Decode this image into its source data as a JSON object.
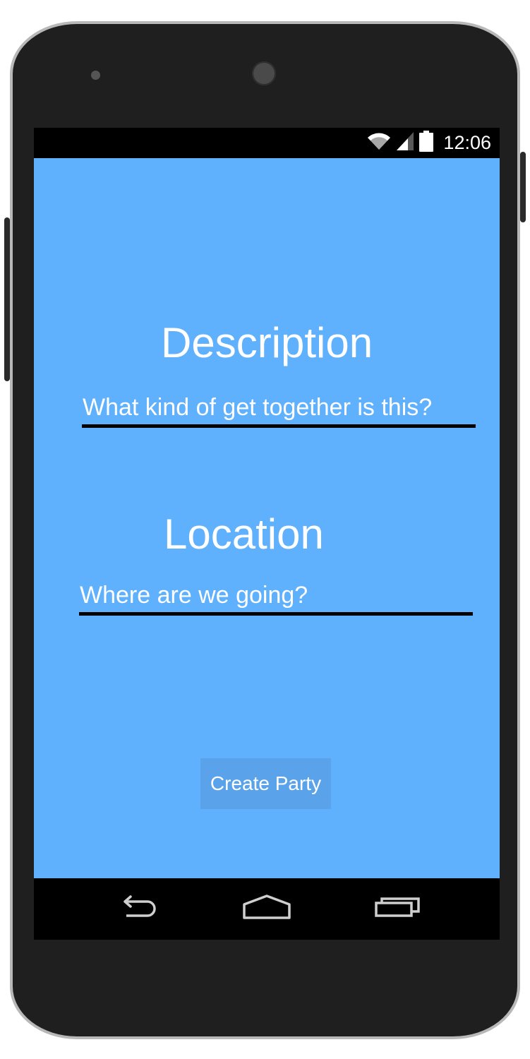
{
  "status_bar": {
    "time": "12:06",
    "icons": [
      "wifi-icon",
      "cell-signal-icon",
      "battery-icon"
    ]
  },
  "form": {
    "description": {
      "label": "Description",
      "placeholder": "What kind of get together is this?"
    },
    "location": {
      "label": "Location",
      "placeholder": "Where are we going?"
    },
    "submit_label": "Create Party"
  },
  "nav_bar": {
    "buttons": [
      "back-icon",
      "home-icon",
      "recent-apps-icon"
    ]
  },
  "colors": {
    "screen_background": "#5fb0fd",
    "button_background": "#5aa3ea",
    "text": "#ffffff",
    "underline": "#000000",
    "bars": "#000000",
    "device_body": "#1f1f1f"
  }
}
